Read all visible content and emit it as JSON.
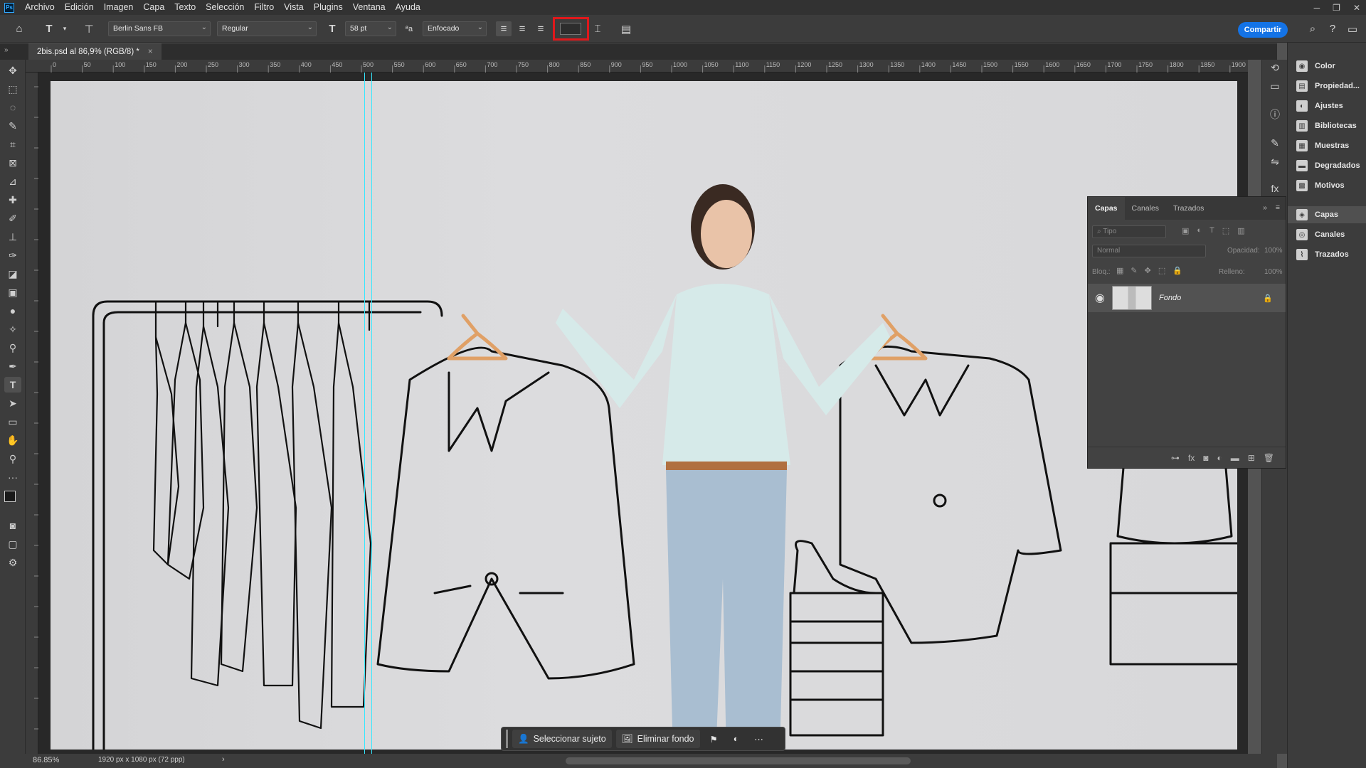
{
  "app": {
    "menu": [
      "Archivo",
      "Edición",
      "Imagen",
      "Capa",
      "Texto",
      "Selección",
      "Filtro",
      "Vista",
      "Plugins",
      "Ventana",
      "Ayuda"
    ]
  },
  "options_bar": {
    "font_family": "Berlin Sans FB",
    "font_style": "Regular",
    "font_size": "58 pt",
    "antialias": "Enfocado",
    "text_color": "#2d2d2d",
    "share_label": "Compartir"
  },
  "document": {
    "tab_title": "2bis.psd al 86,9% (RGB/8) *",
    "close_glyph": "×",
    "ruler_ticks": [
      "0",
      "50",
      "100",
      "150",
      "200",
      "250",
      "300",
      "350",
      "400",
      "450",
      "500",
      "550",
      "600",
      "650",
      "700",
      "750",
      "800",
      "850",
      "900",
      "950",
      "1000",
      "1050",
      "1100",
      "1150",
      "1200",
      "1250",
      "1300",
      "1350",
      "1400",
      "1450",
      "1500",
      "1550",
      "1600",
      "1650",
      "1700",
      "1750",
      "1800",
      "1850",
      "1900"
    ]
  },
  "status_bar": {
    "zoom": "86.85%",
    "doc_info": "1920 px x 1080 px (72 ppp)"
  },
  "contextual_bar": {
    "select_subject": "Seleccionar sujeto",
    "remove_bg": "Eliminar fondo"
  },
  "right_panel": {
    "items": [
      "Color",
      "Propiedad...",
      "Ajustes",
      "Bibliotecas",
      "Muestras",
      "Degradados",
      "Motivos",
      "Capas",
      "Canales",
      "Trazados"
    ]
  },
  "layers_panel": {
    "tabs": [
      "Capas",
      "Canales",
      "Trazados"
    ],
    "filter_placeholder": "Tipo",
    "blend_mode": "Normal",
    "opacity_label": "Opacidad:",
    "opacity_value": "100%",
    "lock_label": "Bloq.:",
    "fill_label": "Relleno:",
    "fill_value": "100%",
    "layer_name": "Fondo"
  }
}
